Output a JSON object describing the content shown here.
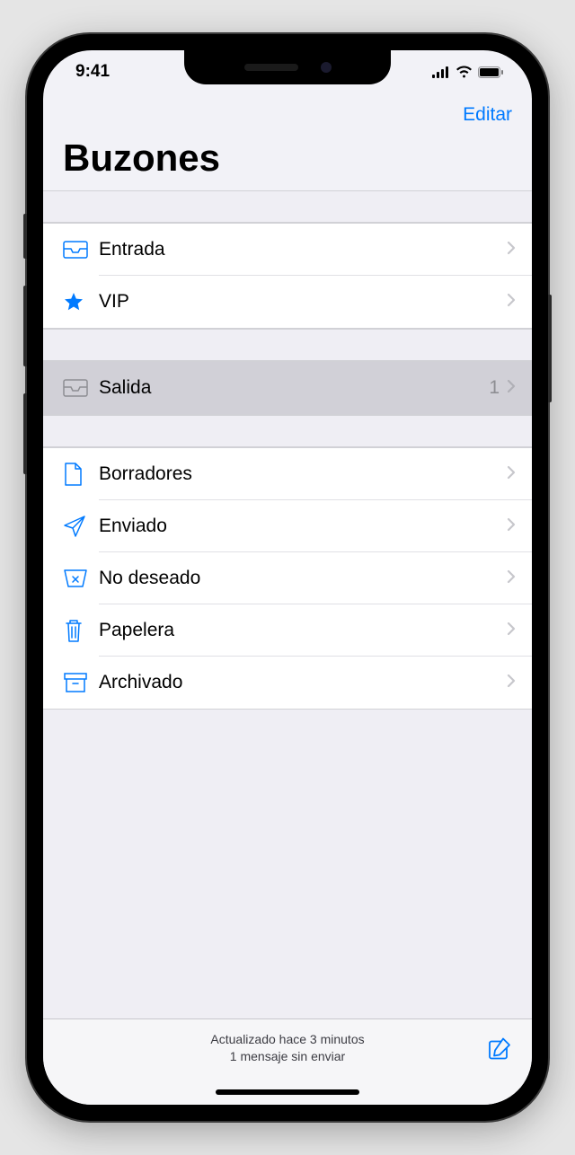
{
  "status": {
    "time": "9:41"
  },
  "nav": {
    "edit": "Editar"
  },
  "title": "Buzones",
  "mailboxes": {
    "primary": [
      {
        "label": "Entrada",
        "count": ""
      },
      {
        "label": "VIP",
        "count": ""
      }
    ],
    "outbox": {
      "label": "Salida",
      "count": "1"
    },
    "account": [
      {
        "label": "Borradores"
      },
      {
        "label": "Enviado"
      },
      {
        "label": "No deseado"
      },
      {
        "label": "Papelera"
      },
      {
        "label": "Archivado"
      }
    ]
  },
  "toolbar": {
    "line1": "Actualizado hace 3 minutos",
    "line2": "1 mensaje sin enviar"
  }
}
